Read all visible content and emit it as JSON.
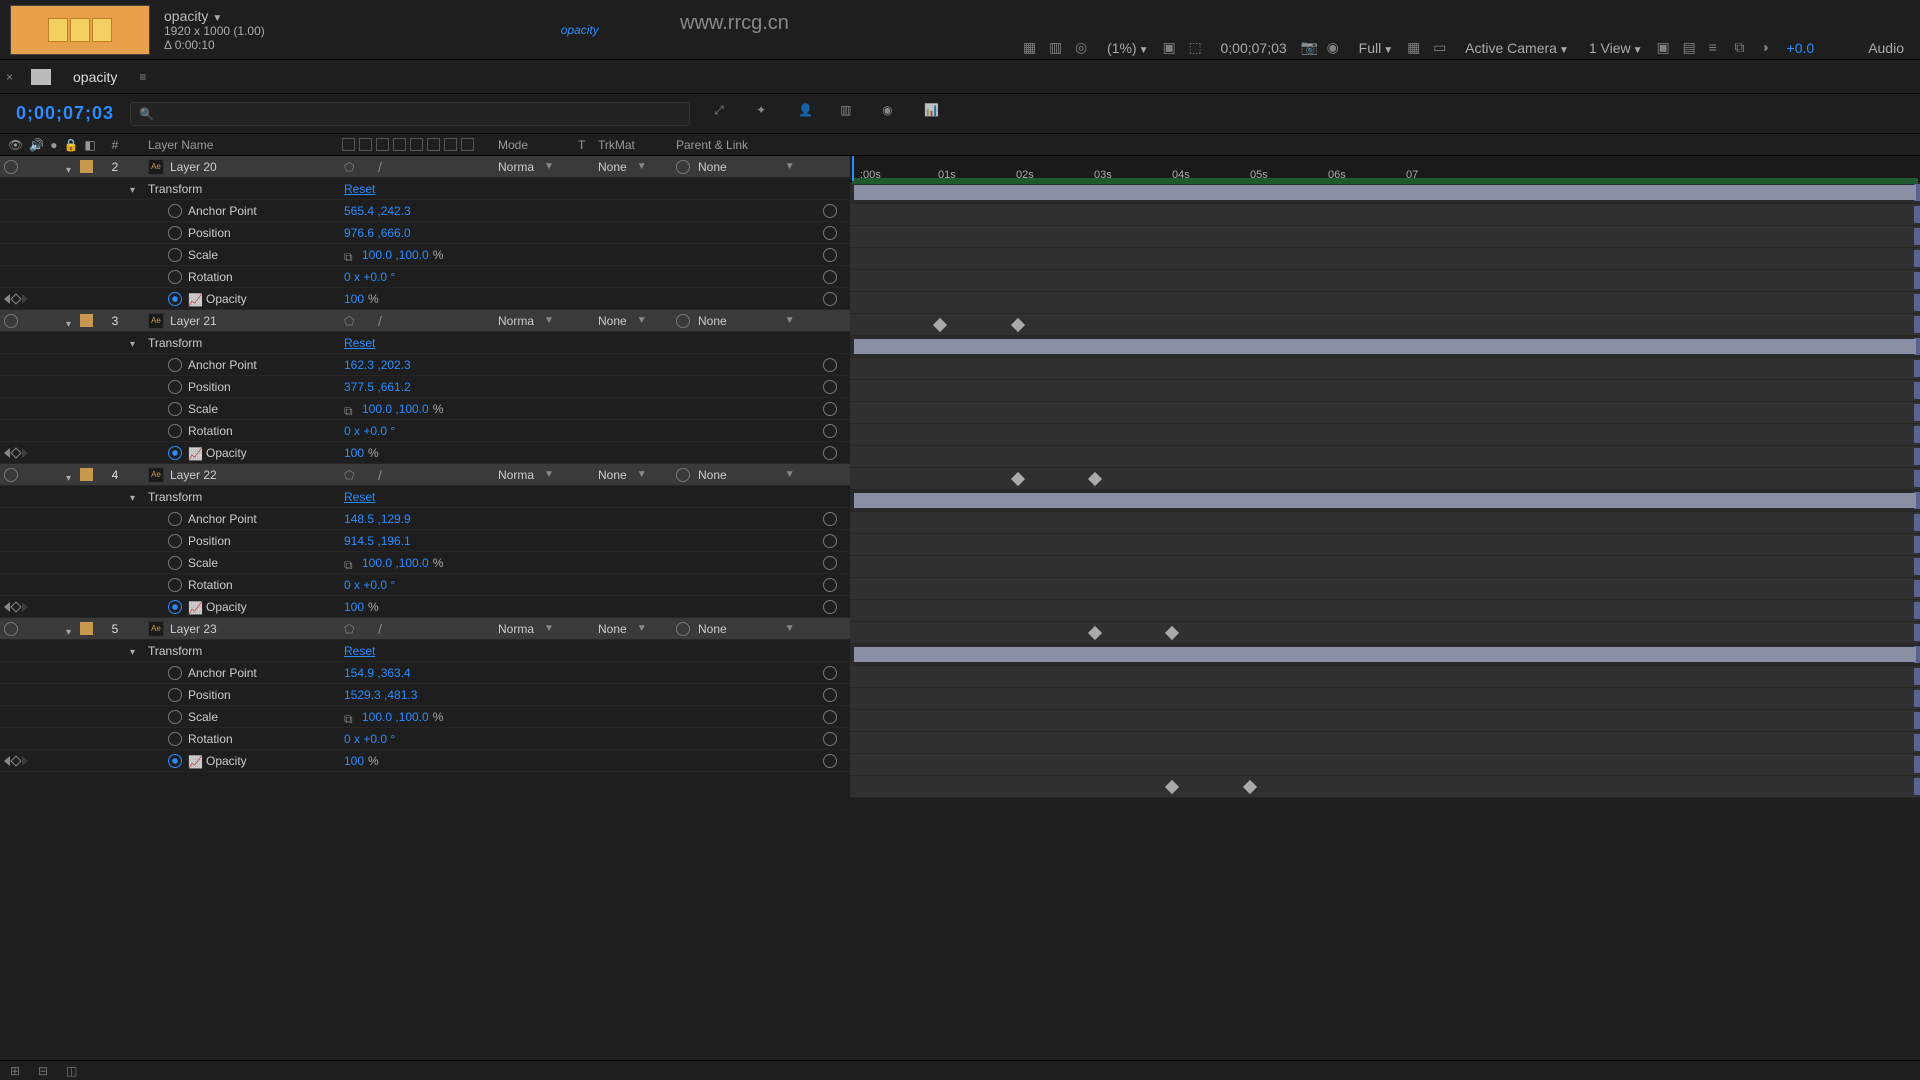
{
  "comp": {
    "name": "opacity",
    "dims": "1920 x 1000 (1.00)",
    "dur": "Δ 0:00:10"
  },
  "viewer": {
    "tab": "opacity",
    "url": "www.rrcg.cn",
    "zoom": "(1%)",
    "timecode": "0;00;07;03",
    "res": "Full",
    "camera": "Active Camera",
    "views": "1 View",
    "exposure": "+0.0",
    "audio": "Audio"
  },
  "panel": {
    "tab": "opacity",
    "timecode": "0;00;07;03"
  },
  "columns": {
    "num": "#",
    "name": "Layer Name",
    "mode": "Mode",
    "t": "T",
    "trk": "TrkMat",
    "parent": "Parent & Link"
  },
  "vals": {
    "reset": "Reset",
    "normal": "Norma",
    "none": "None",
    "transform": "Transform",
    "anchor": "Anchor Point",
    "position": "Position",
    "scale": "Scale",
    "rotation": "Rotation",
    "opacity": "Opacity"
  },
  "layers": [
    {
      "idx": "2",
      "name": "Layer 20",
      "anchor": "565.4 ,242.3",
      "pos": "976.6 ,666.0",
      "scale": "100.0 ,100.0",
      "scale_u": "%",
      "rot": "0 x +0.0 °",
      "opa": "100",
      "opa_u": "%",
      "kf": [
        940,
        1018
      ]
    },
    {
      "idx": "3",
      "name": "Layer 21",
      "anchor": "162.3 ,202.3",
      "pos": "377.5 ,661.2",
      "scale": "100.0 ,100.0",
      "scale_u": "%",
      "rot": "0 x +0.0 °",
      "opa": "100",
      "opa_u": "%",
      "kf": [
        1018,
        1095
      ]
    },
    {
      "idx": "4",
      "name": "Layer 22",
      "anchor": "148.5 ,129.9",
      "pos": "914.5 ,196.1",
      "scale": "100.0 ,100.0",
      "scale_u": "%",
      "rot": "0 x +0.0 °",
      "opa": "100",
      "opa_u": "%",
      "kf": [
        1095,
        1172
      ]
    },
    {
      "idx": "5",
      "name": "Layer 23",
      "anchor": "154.9 ,363.4",
      "pos": "1529.3 ,481.3",
      "scale": "100.0 ,100.0",
      "scale_u": "%",
      "rot": "0 x +0.0 °",
      "opa": "100",
      "opa_u": "%",
      "kf": [
        1172,
        1250
      ]
    }
  ],
  "ruler": [
    ":00s",
    "01s",
    "02s",
    "03s",
    "04s",
    "05s",
    "06s",
    "07"
  ]
}
